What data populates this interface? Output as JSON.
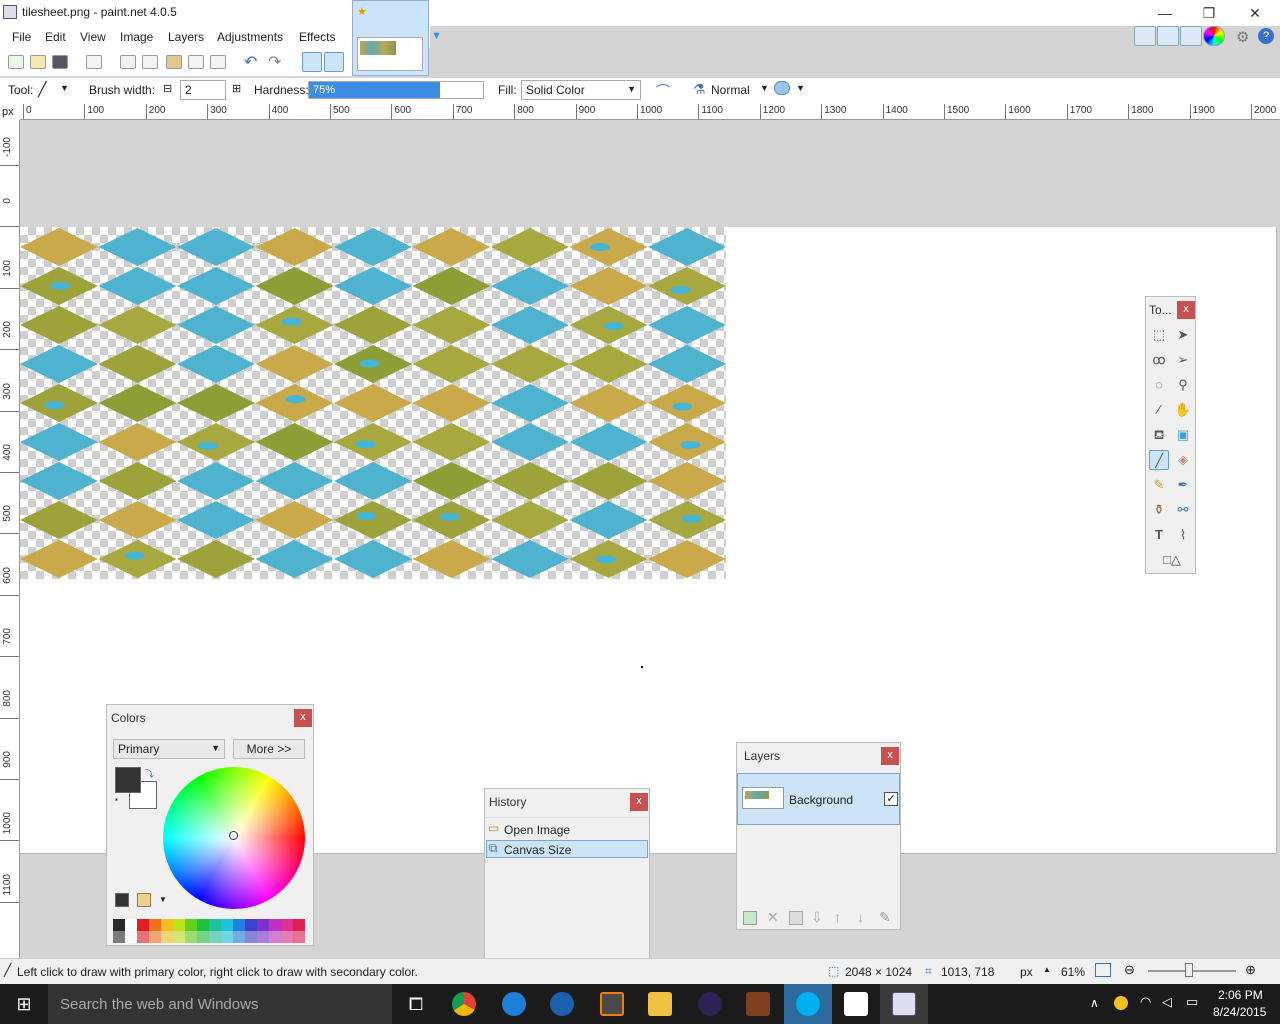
{
  "window": {
    "title": "tilesheet.png - paint.net 4.0.5",
    "minimize": "—",
    "restore": "❐",
    "close": "✕"
  },
  "menu": [
    "File",
    "Edit",
    "View",
    "Image",
    "Layers",
    "Adjustments",
    "Effects"
  ],
  "toolbar": {
    "tool_label": "Tool:",
    "brush_width_label": "Brush width:",
    "brush_width_value": "2",
    "hardness_label": "Hardness:",
    "hardness_value": "75%",
    "hardness_fraction": 0.75,
    "fill_label": "Fill:",
    "fill_value": "Solid Color",
    "blend_mode": "Normal"
  },
  "ruler": {
    "unit": "px",
    "h_ticks": [
      "0",
      "100",
      "200",
      "300",
      "400",
      "500",
      "600",
      "700",
      "800",
      "900",
      "1000",
      "1100",
      "1200",
      "1300",
      "1400",
      "1500",
      "1600",
      "1700",
      "1800",
      "1900",
      "2000"
    ],
    "v_ticks": [
      "-100",
      "0",
      "100",
      "200",
      "300",
      "400",
      "500",
      "600",
      "700",
      "800",
      "900",
      "1000",
      "1100"
    ]
  },
  "tools_panel": {
    "title": "To...",
    "close": "x",
    "tools": [
      "rectangle-select",
      "move-selected-pixels",
      "lasso-select",
      "move-selection",
      "ellipse-select",
      "zoom",
      "magic-wand",
      "pan",
      "paint-bucket",
      "gradient",
      "paintbrush",
      "eraser",
      "pencil",
      "color-picker",
      "clone-stamp",
      "recolor",
      "text",
      "line-curve",
      "shapes"
    ]
  },
  "colors_panel": {
    "title": "Colors",
    "close": "x",
    "mode": "Primary",
    "more_button": "More >>",
    "primary_color": "#333333",
    "secondary_color": "#ffffff",
    "palette": [
      "#2b2b2b",
      "#ffffff",
      "#e02020",
      "#f07020",
      "#f0c020",
      "#c0e020",
      "#60d020",
      "#20c040",
      "#20c0a0",
      "#20c0e0",
      "#2080e0",
      "#4040d0",
      "#8030d0",
      "#c030c0",
      "#e03090",
      "#e02050"
    ]
  },
  "history_panel": {
    "title": "History",
    "close": "x",
    "items": [
      "Open Image",
      "Canvas Size"
    ],
    "selected": 1
  },
  "layers_panel": {
    "title": "Layers",
    "close": "x",
    "layers": [
      {
        "name": "Background",
        "visible": true
      }
    ]
  },
  "status": {
    "hint": "Left click to draw with primary color, right click to draw with secondary color.",
    "image_size": "2048 × 1024",
    "cursor_pos": "1013, 718",
    "unit": "px",
    "zoom": "61%",
    "zoom_fraction": 0.61
  },
  "taskbar": {
    "search_placeholder": "Search the web and Windows",
    "time": "2:06 PM",
    "date": "8/24/2015"
  }
}
